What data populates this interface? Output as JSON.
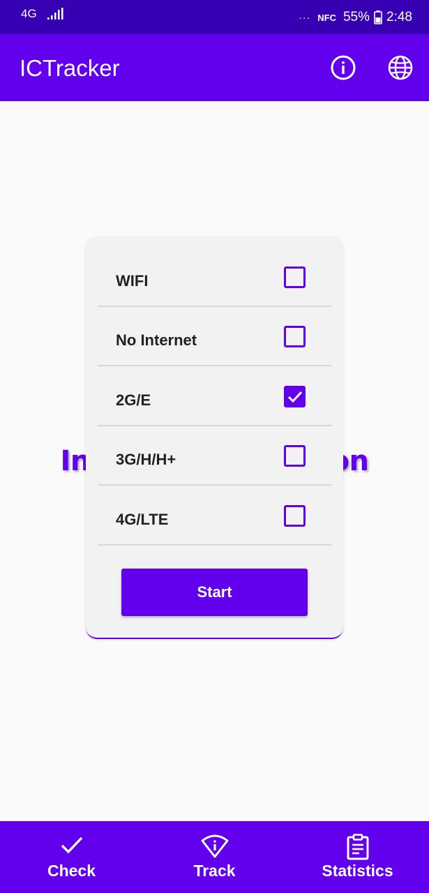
{
  "status_bar": {
    "network": "4G",
    "dots": "···",
    "nfc": "NFC",
    "battery": "55%",
    "time": "2:48"
  },
  "app_bar": {
    "title": "ICTracker",
    "icons": [
      "info-icon",
      "globe-icon"
    ]
  },
  "background_heading": "Internet Connection Tracker",
  "dialog": {
    "options": [
      {
        "label": "WIFI",
        "checked": false
      },
      {
        "label": "No Internet",
        "checked": false
      },
      {
        "label": "2G/E",
        "checked": true
      },
      {
        "label": "3G/H/H+",
        "checked": false
      },
      {
        "label": "4G/LTE",
        "checked": false
      }
    ],
    "start_label": "Start"
  },
  "bottom_nav": {
    "items": [
      {
        "label": "Check",
        "icon": "check-icon"
      },
      {
        "label": "Track",
        "icon": "wifi-info-icon"
      },
      {
        "label": "Statistics",
        "icon": "clipboard-icon"
      }
    ]
  },
  "colors": {
    "primary": "#6200ee",
    "primary_dark": "#3700b3"
  }
}
